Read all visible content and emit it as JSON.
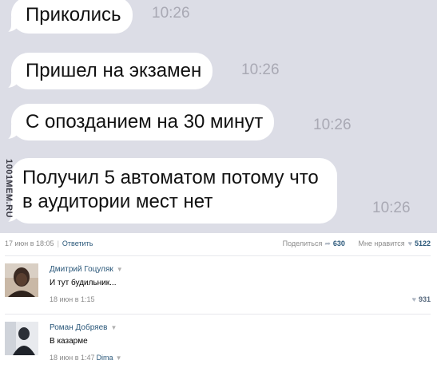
{
  "messages": [
    {
      "text": "Приколись",
      "time": "10:26"
    },
    {
      "text": "Пришел на экзамен",
      "time": "10:26"
    },
    {
      "text": "С опозданием на 30 минут",
      "time": "10:26"
    },
    {
      "text": "Получил 5 автоматом потому что в аудитории мест нет",
      "time": "10:26"
    }
  ],
  "watermark": "1001MEM.RU",
  "post_meta": {
    "date": "17 июн в 18:05",
    "reply_label": "Ответить",
    "share_label": "Поделиться",
    "share_count": "630",
    "like_label": "Мне нравится",
    "like_count": "5122"
  },
  "comments": [
    {
      "author": "Дмитрий Гоцуляк",
      "text": "И тут будильник...",
      "date": "18 июн в 1:15",
      "likes": "931"
    },
    {
      "author": "Роман Добряев",
      "text": "В казарме",
      "date": "18 июн в 1:47",
      "reply_to": "Dima"
    }
  ]
}
